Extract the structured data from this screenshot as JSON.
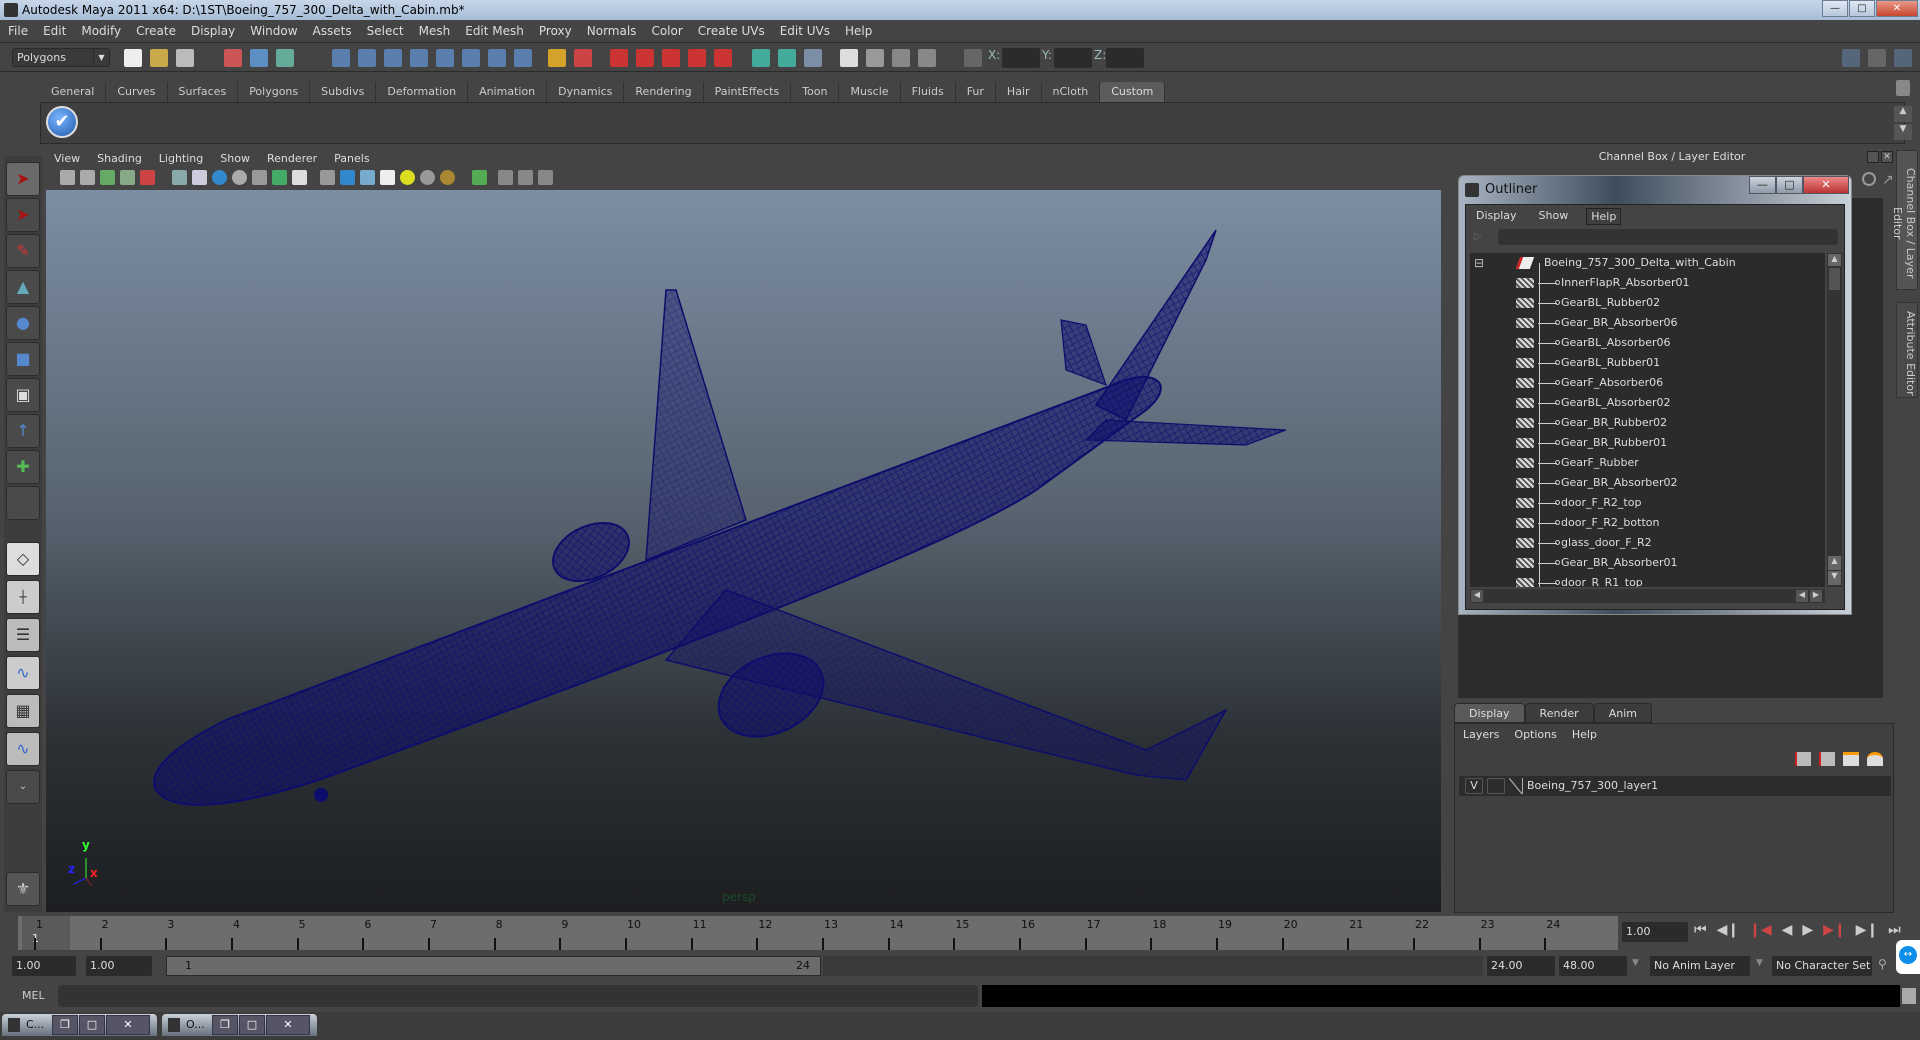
{
  "window": {
    "title": "Autodesk Maya 2011 x64: D:\\1ST\\Boeing_757_300_Delta_with_Cabin.mb*",
    "controls": [
      "minimize",
      "maximize",
      "close"
    ]
  },
  "menubar": {
    "items": [
      "File",
      "Edit",
      "Modify",
      "Create",
      "Display",
      "Window",
      "Assets",
      "Select",
      "Mesh",
      "Edit Mesh",
      "Proxy",
      "Normals",
      "Color",
      "Create UVs",
      "Edit UVs",
      "Help"
    ]
  },
  "statusline": {
    "mode": "Polygons",
    "coord_labels": [
      "X:",
      "Y:",
      "Z:"
    ],
    "coord_values": [
      "",
      "",
      ""
    ]
  },
  "shelf": {
    "tabs": [
      "General",
      "Curves",
      "Surfaces",
      "Polygons",
      "Subdivs",
      "Deformation",
      "Animation",
      "Dynamics",
      "Rendering",
      "PaintEffects",
      "Toon",
      "Muscle",
      "Fluids",
      "Fur",
      "Hair",
      "nCloth",
      "Custom"
    ],
    "active_tab": "Custom",
    "shelf_button_icon": "check-icon"
  },
  "viewport": {
    "menu": [
      "View",
      "Shading",
      "Lighting",
      "Show",
      "Renderer",
      "Panels"
    ],
    "camera_label": "persp",
    "axis_labels": {
      "x": "x",
      "y": "y",
      "z": "z"
    },
    "wireframe_color": "#0d0d6b"
  },
  "toolbox": {
    "tools": [
      "select-tool",
      "lasso-tool",
      "paint-select-tool",
      "move-tool",
      "rotate-tool",
      "scale-tool",
      "universal-manipulator",
      "soft-mod-tool",
      "show-manipulator",
      "last-tool-slot"
    ]
  },
  "channel_box": {
    "header": "Channel Box / Layer Editor",
    "side_tabs": [
      "Channel Box / Layer Editor",
      "Attribute Editor"
    ]
  },
  "outliner": {
    "title": "Outliner",
    "menu": [
      "Display",
      "Show",
      "Help"
    ],
    "root": "Boeing_757_300_Delta_with_Cabin",
    "items": [
      "InnerFlapR_Absorber01",
      "GearBL_Rubber02",
      "Gear_BR_Absorber06",
      "GearBL_Absorber06",
      "GearBL_Rubber01",
      "GearF_Absorber06",
      "GearBL_Absorber02",
      "Gear_BR_Rubber02",
      "Gear_BR_Rubber01",
      "GearF_Rubber",
      "Gear_BR_Absorber02",
      "door_F_R2_top",
      "door_F_R2_botton",
      "glass_door_F_R2",
      "Gear_BR_Absorber01",
      "door_R_R1_top"
    ]
  },
  "layer_editor": {
    "tabs": [
      "Display",
      "Render",
      "Anim"
    ],
    "active_tab": "Display",
    "menu": [
      "Layers",
      "Options",
      "Help"
    ],
    "layers": [
      {
        "visible": "V",
        "name": "Boeing_757_300_layer1"
      }
    ]
  },
  "timeline": {
    "ticks": [
      "1",
      "2",
      "3",
      "4",
      "5",
      "6",
      "7",
      "8",
      "9",
      "10",
      "11",
      "12",
      "13",
      "14",
      "15",
      "16",
      "17",
      "18",
      "19",
      "20",
      "21",
      "22",
      "23",
      "24"
    ],
    "current_marker": "1",
    "current_frame": "1.00"
  },
  "range": {
    "start": "1.00",
    "anim_start": "1.00",
    "slider_start": "1",
    "slider_end": "24",
    "end": "24.00",
    "anim_end": "48.00",
    "anim_layer": "No Anim Layer",
    "character_set": "No Character Set"
  },
  "command_line": {
    "label": "MEL",
    "value": ""
  },
  "taskbar": {
    "windows": [
      "C...",
      "O..."
    ]
  }
}
